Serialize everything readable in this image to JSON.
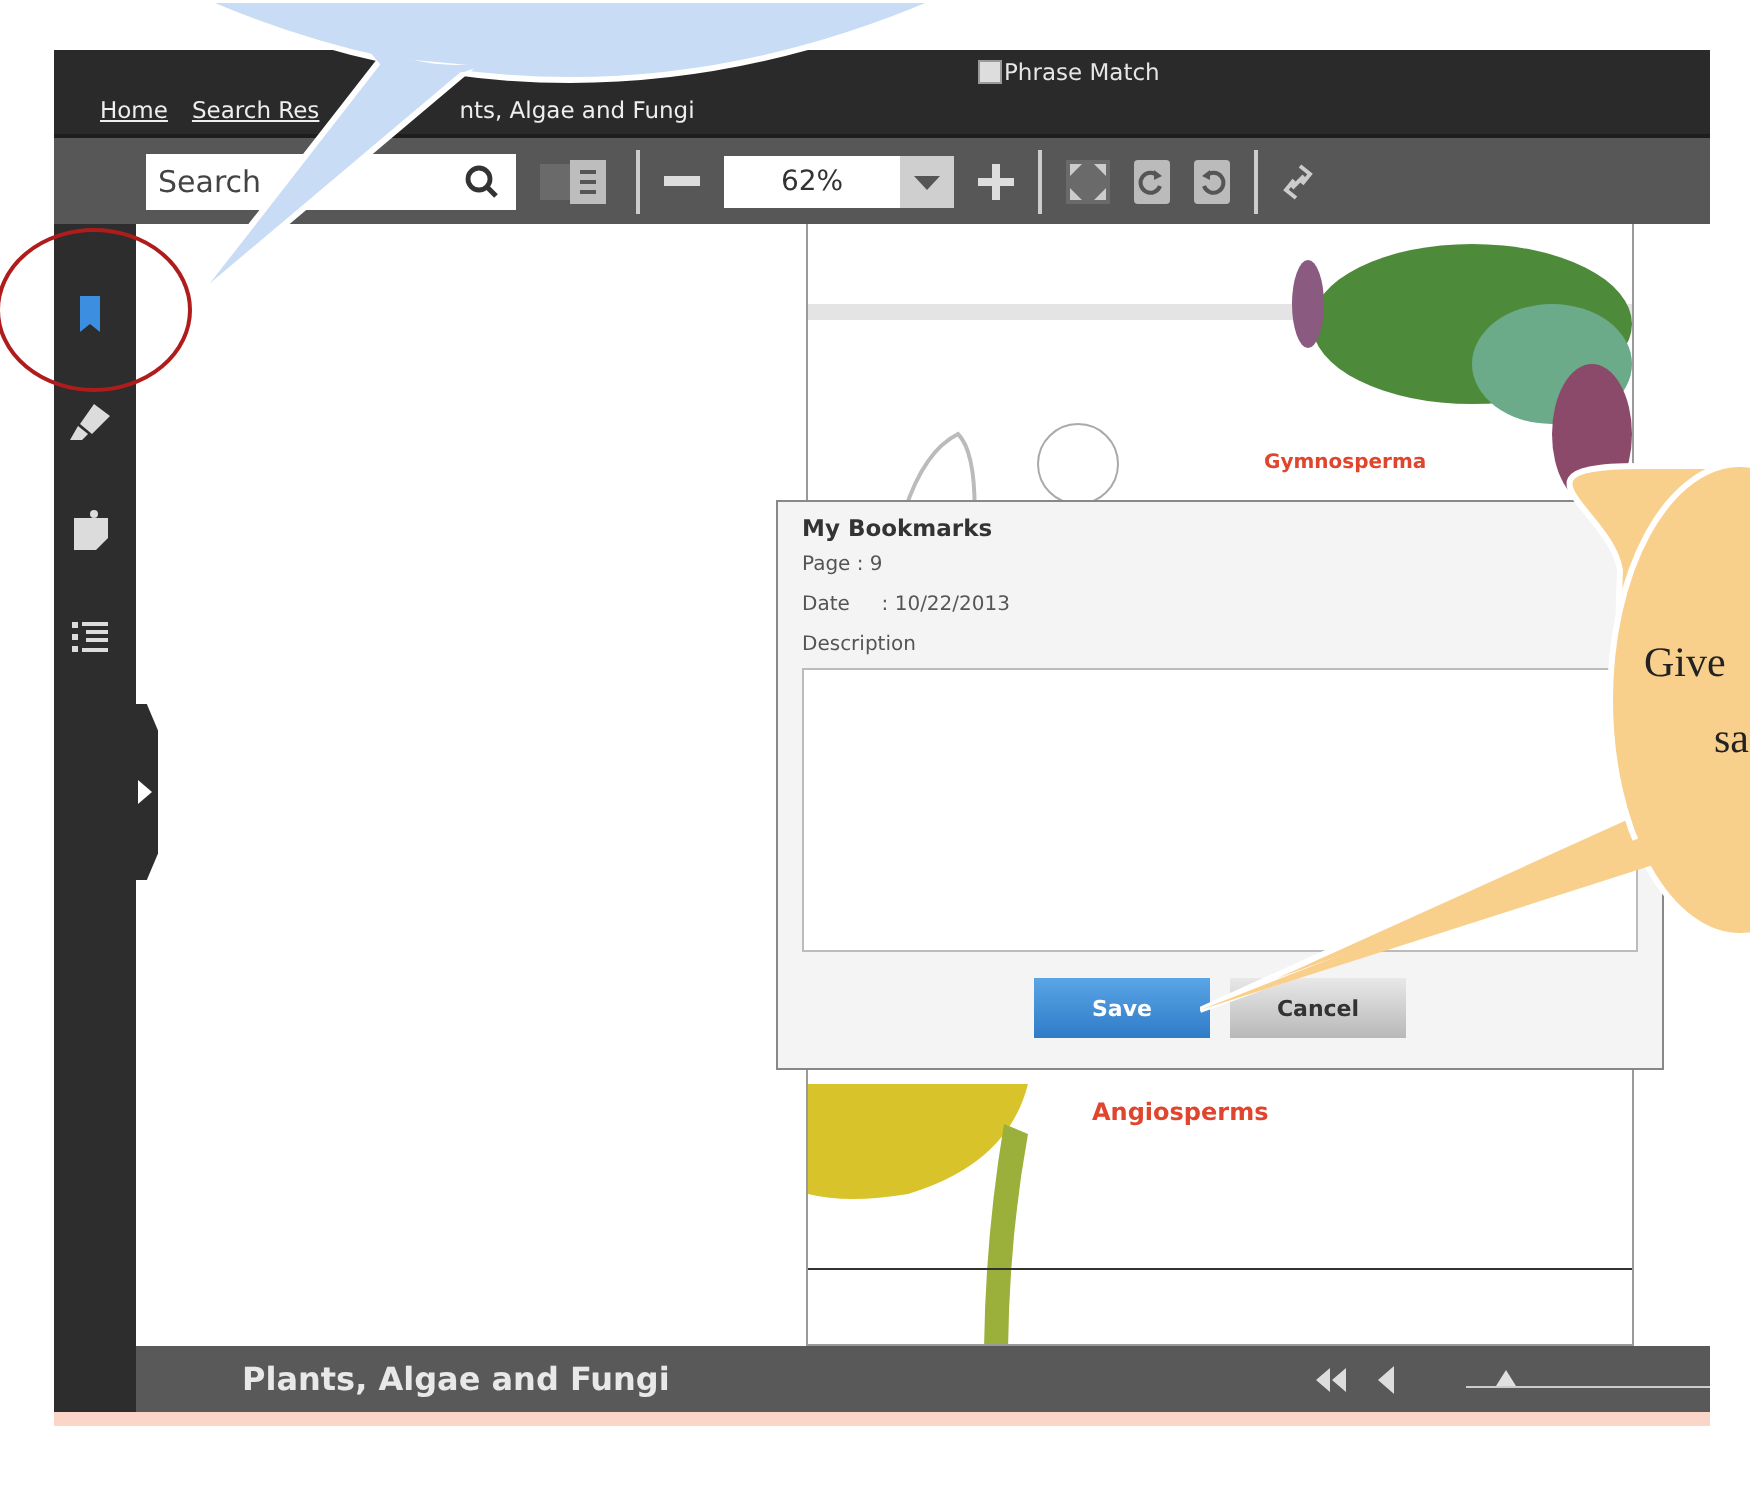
{
  "phrase_match": {
    "label": "Phrase Match",
    "checked": false
  },
  "breadcrumb": [
    {
      "text": "Home",
      "link": true
    },
    {
      "text": "Search Res",
      "link": true
    },
    {
      "text": "nts, Algae and Fungi",
      "link": false
    }
  ],
  "toolbar": {
    "search": {
      "placeholder": "Search"
    },
    "zoom": {
      "value": "62%"
    }
  },
  "sidebar": {
    "items": [
      {
        "kind": "bookmark",
        "selected": true
      },
      {
        "kind": "highlight",
        "selected": false
      },
      {
        "kind": "note",
        "selected": false
      },
      {
        "kind": "contents",
        "selected": false
      }
    ]
  },
  "page": {
    "headings": [
      "Gymnosperma",
      "Angiosperms"
    ]
  },
  "dialog": {
    "title": "My Bookmarks",
    "lines": [
      "Page : 9",
      "Date     : 10/22/2013"
    ],
    "description": {
      "label": "Description"
    },
    "buttons": [
      {
        "label": "Save",
        "kind": "primary"
      },
      {
        "label": "Cancel",
        "kind": "secondary"
      }
    ]
  },
  "bottom_bar": {
    "title": "Plants, Algae and Fungi",
    "slider": {
      "level": 0.12
    }
  },
  "callout": {
    "lines": [
      "Give",
      "sa"
    ]
  }
}
